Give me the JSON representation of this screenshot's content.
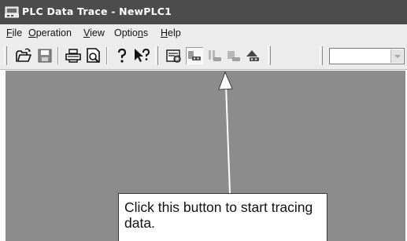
{
  "window": {
    "title": "PLC Data Trace - NewPLC1",
    "app_icon": "plc-trace-app-icon"
  },
  "menu": [
    {
      "label": "File",
      "accelerator": "F"
    },
    {
      "label": "Operation",
      "accelerator": "O"
    },
    {
      "label": "View",
      "accelerator": "V"
    },
    {
      "label": "Options",
      "accelerator": "n"
    },
    {
      "label": "Help",
      "accelerator": "H"
    }
  ],
  "toolbar": {
    "buttons": [
      {
        "icon": "open-folder-icon"
      },
      {
        "icon": "save-disk-icon"
      },
      {
        "icon": "printer-icon"
      },
      {
        "icon": "print-preview-icon"
      },
      {
        "icon": "help-icon"
      },
      {
        "icon": "context-help-icon"
      },
      {
        "icon": "trace-settings-icon"
      },
      {
        "icon": "start-trace-icon",
        "state": "pressed"
      },
      {
        "icon": "pause-trace-icon",
        "state": "disabled"
      },
      {
        "icon": "stop-trace-icon",
        "state": "disabled"
      },
      {
        "icon": "upload-trace-icon"
      }
    ],
    "combo_value": ""
  },
  "callout": {
    "text": "Click this button to start tracing data."
  },
  "colors": {
    "titlebar": "#4c4c4c",
    "menubar": "#ececec",
    "workspace": "#8c8c8c",
    "title_text": "#ffffff"
  }
}
